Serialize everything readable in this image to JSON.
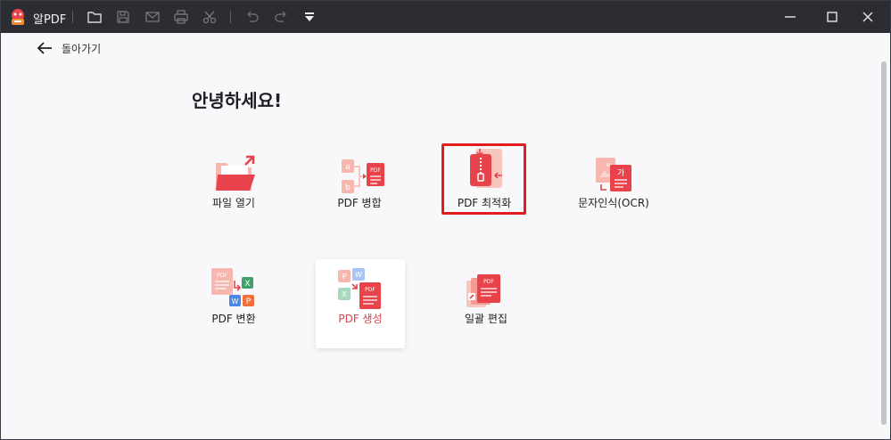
{
  "app": {
    "title": "알PDF"
  },
  "nav": {
    "back_label": "돌아가기"
  },
  "main": {
    "greeting": "안녕하세요!",
    "tiles": [
      {
        "label": "파일 열기"
      },
      {
        "label": "PDF 병합"
      },
      {
        "label": "PDF 최적화"
      },
      {
        "label": "문자인식(OCR)"
      },
      {
        "label": "PDF 변환"
      },
      {
        "label": "PDF 생성"
      },
      {
        "label": "일괄 편집"
      }
    ],
    "ocr_icon_text": "가"
  },
  "colors": {
    "accent": "#e8434b",
    "titlebar": "#2b2d33",
    "highlight": "#e01c1c"
  }
}
